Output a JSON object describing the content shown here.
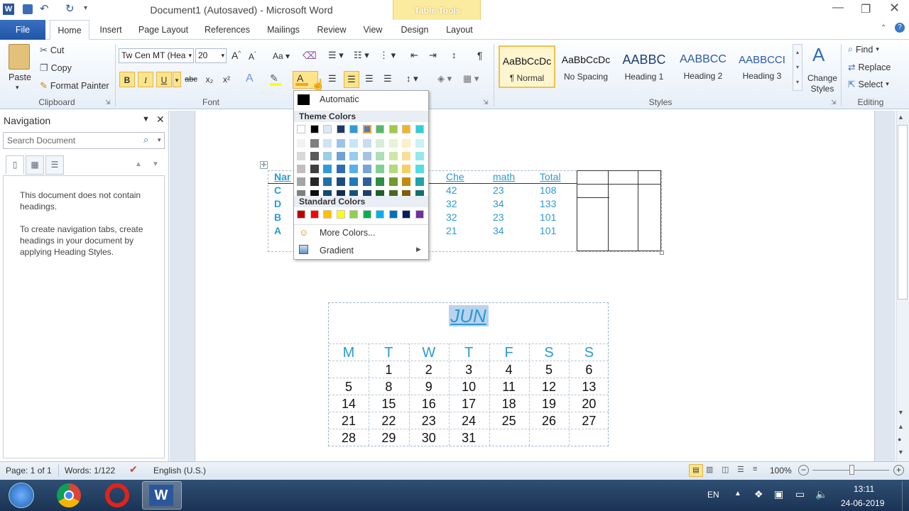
{
  "window": {
    "title": "Document1 (Autosaved) - Microsoft Word"
  },
  "contextual": {
    "label": "Table Tools"
  },
  "tabs": [
    "File",
    "Home",
    "Insert",
    "Page Layout",
    "References",
    "Mailings",
    "Review",
    "View",
    "Design",
    "Layout"
  ],
  "clipboard": {
    "paste": "Paste",
    "cut": "Cut",
    "copy": "Copy",
    "painter": "Format Painter",
    "group": "Clipboard"
  },
  "font": {
    "name": "Tw Cen MT (Hea",
    "size": "20",
    "group": "Font",
    "bold": "B",
    "italic": "I",
    "underline": "U",
    "strike": "abc",
    "sub": "x₂",
    "sup": "x²",
    "grow": "A",
    "shrink": "A",
    "case": "Aa"
  },
  "paragraph": {
    "group": "Paragraph",
    "pilcrow": "¶"
  },
  "styles": {
    "group": "Styles",
    "items": [
      {
        "preview": "AaBbCcDc",
        "name": "¶ Normal"
      },
      {
        "preview": "AaBbCcDc",
        "name": "No Spacing"
      },
      {
        "preview": "AABBC",
        "name": "Heading 1"
      },
      {
        "preview": "AABBCC",
        "name": "Heading 2"
      },
      {
        "preview": "AABBCCI",
        "name": "Heading 3"
      }
    ],
    "change": "Change Styles"
  },
  "editing": {
    "group": "Editing",
    "find": "Find",
    "replace": "Replace",
    "select": "Select"
  },
  "nav": {
    "title": "Navigation",
    "search": "Search Document",
    "msg1": "This document does not contain headings.",
    "msg2": "To create navigation tabs, create headings in your document by applying Heading Styles."
  },
  "table1": {
    "first": [
      "Nar",
      "C",
      "D",
      "B",
      "A"
    ],
    "headers": [
      "Che",
      "math",
      "Total"
    ],
    "rows": [
      [
        "42",
        "23",
        "108"
      ],
      [
        "32",
        "34",
        "133"
      ],
      [
        "32",
        "23",
        "101"
      ],
      [
        "21",
        "34",
        "101"
      ]
    ]
  },
  "calendar": {
    "month": "JUN",
    "days": [
      "M",
      "T",
      "W",
      "T",
      "F",
      "S",
      "S"
    ],
    "weeks": [
      [
        "",
        "1",
        "2",
        "3",
        "4",
        "5",
        "6"
      ],
      [
        "5",
        "8",
        "9",
        "10",
        "11",
        "12",
        "13"
      ],
      [
        "14",
        "15",
        "16",
        "17",
        "18",
        "19",
        "20"
      ],
      [
        "21",
        "22",
        "23",
        "24",
        "25",
        "26",
        "27"
      ],
      [
        "28",
        "29",
        "30",
        "31",
        "",
        "",
        ""
      ]
    ]
  },
  "colorMenu": {
    "automatic": "Automatic",
    "theme": "Theme Colors",
    "standard": "Standard Colors",
    "more": "More Colors...",
    "gradient": "Gradient",
    "themeTop": [
      "#ffffff",
      "#000000",
      "#dbe9f6",
      "#1f3864",
      "#2f9ad8",
      "#4a7fc1",
      "#55b96a",
      "#9ccc4a",
      "#f2b51f",
      "#2fcfd6"
    ],
    "themeShades": [
      [
        "#f2f2f2",
        "#7f7f7f",
        "#cce4f5",
        "#9dc3ea",
        "#c6e5f8",
        "#cbdcf0",
        "#d5eedb",
        "#e7f3d2",
        "#fcefc9",
        "#c9f3f5"
      ],
      [
        "#d9d9d9",
        "#595959",
        "#9ccde9",
        "#6fa1d9",
        "#95cdf0",
        "#a5c2e6",
        "#abdfb8",
        "#cfe7a8",
        "#f9df96",
        "#95e8ec"
      ],
      [
        "#bfbfbf",
        "#3f3f3f",
        "#2f9ad8",
        "#2f6cb3",
        "#55b0e7",
        "#7aa4d8",
        "#7fd096",
        "#b3da7b",
        "#f6cf62",
        "#55dde3"
      ],
      [
        "#a5a5a5",
        "#262626",
        "#1f72a8",
        "#1f4a7e",
        "#1f7bb8",
        "#2f5f99",
        "#2f8e46",
        "#6f9a2f",
        "#c48a0f",
        "#1fa4aa"
      ],
      [
        "#7f7f7f",
        "#0c0c0c",
        "#134a70",
        "#122c4f",
        "#14527b",
        "#1f3f66",
        "#1f5f2f",
        "#4a6620",
        "#835c0a",
        "#136d72"
      ]
    ],
    "standardColors": [
      "#c00000",
      "#ff0000",
      "#ffc000",
      "#ffff00",
      "#92d050",
      "#00b050",
      "#00b0f0",
      "#0070c0",
      "#002060",
      "#7030a0"
    ]
  },
  "status": {
    "page": "Page: 1 of 1",
    "words": "Words: 1/122",
    "lang": "English (U.S.)",
    "zoom": "100%"
  },
  "tray": {
    "lang": "EN",
    "time": "13:11",
    "date": "24-06-2019"
  }
}
